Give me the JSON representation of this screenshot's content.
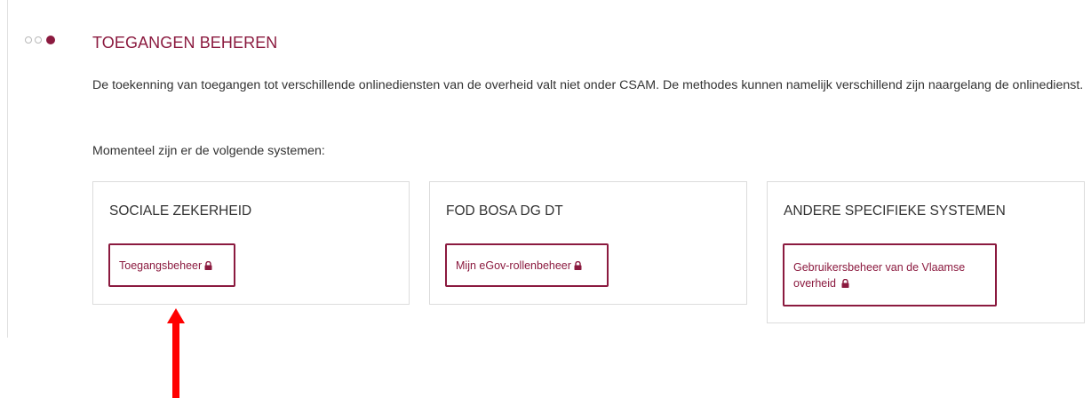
{
  "section": {
    "title": "TOEGANGEN BEHEREN",
    "intro": "De toekenning van toegangen tot verschillende onlinediensten van de overheid valt niet onder CSAM. De methodes kunnen namelijk verschillend zijn naargelang de onlinedienst.",
    "lead": "Momenteel zijn er de volgende systemen:"
  },
  "cards": [
    {
      "title": "SOCIALE ZEKERHEID",
      "button_label": "Toegangsbeheer"
    },
    {
      "title": "FOD BOSA DG DT",
      "button_label": "Mijn eGov-rollenbeheer"
    },
    {
      "title": "ANDERE SPECIFIEKE SYSTEMEN",
      "button_label": "Gebruikersbeheer van de Vlaamse overheid"
    }
  ],
  "colors": {
    "accent": "#8b1a3f",
    "annotation_arrow": "#ff0000",
    "text": "#333333",
    "border": "#dcdcdc"
  },
  "icons": {
    "button_lock": "lock-icon",
    "step_indicator": "step-dots-icon",
    "annotation": "arrow-up-icon"
  }
}
